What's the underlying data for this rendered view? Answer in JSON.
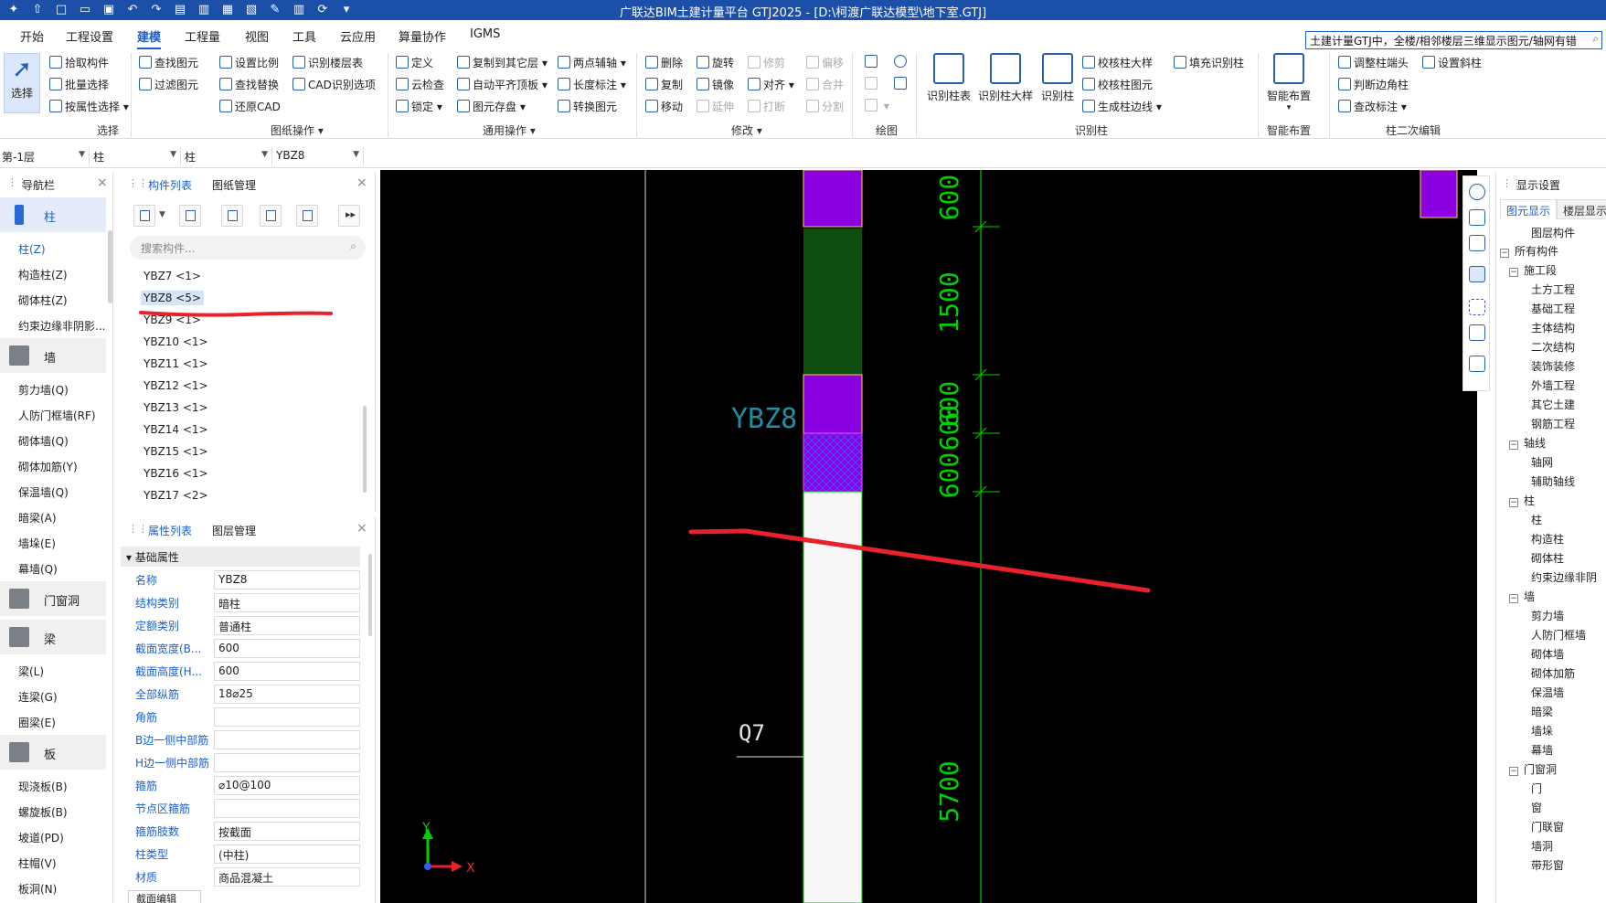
{
  "window": {
    "title": "广联达BIM土建计量平台 GTJ2025 - [D:\\柯渡广联达模型\\地下室.GTJ]"
  },
  "menu": {
    "tabs": [
      "开始",
      "工程设置",
      "建模",
      "工程量",
      "视图",
      "工具",
      "云应用",
      "算量协作",
      "IGMS"
    ],
    "active": "建模",
    "search_value": "土建计量GTJ中，全楼/相邻楼层三维显示图元/轴网有错"
  },
  "ribbon": {
    "select": {
      "big": "选择",
      "items": [
        "拾取构件",
        "批量选择",
        "按属性选择"
      ],
      "group": "选择"
    },
    "drawing_ops": {
      "items": [
        "查找图元",
        "过滤图元",
        "设置比例",
        "查找替换",
        "还原CAD",
        "识别楼层表",
        "CAD识别选项"
      ],
      "group": "图纸操作"
    },
    "general_ops": {
      "items": [
        "定义",
        "云检查",
        "锁定",
        "复制到其它层",
        "自动平齐顶板",
        "图元存盘",
        "两点辅轴",
        "长度标注",
        "转换图元"
      ],
      "group": "通用操作"
    },
    "modify": {
      "items": [
        "删除",
        "复制",
        "移动",
        "旋转",
        "镜像",
        "延伸",
        "修剪",
        "对齐",
        "打断",
        "偏移",
        "合并",
        "分割"
      ],
      "group": "修改"
    },
    "draw": {
      "group": "绘图"
    },
    "identify_column": {
      "bigs": [
        "识别柱表",
        "识别柱大样",
        "识别柱"
      ],
      "items": [
        "校核柱大样",
        "校核柱图元",
        "生成柱边线",
        "填充识别柱"
      ],
      "group": "识别柱"
    },
    "smart_layout": {
      "big": "智能布置",
      "group": "智能布置"
    },
    "column_secondary": {
      "items": [
        "调整柱端头",
        "判断边角柱",
        "查改标注",
        "设置斜柱"
      ],
      "group": "柱二次编辑"
    }
  },
  "layerbar": {
    "floor": "第-1层",
    "type": "柱",
    "subtype": "柱",
    "component": "YBZ8"
  },
  "nav": {
    "title": "导航栏",
    "categories": [
      {
        "label": "柱",
        "items": [
          "柱(Z)",
          "构造柱(Z)",
          "砌体柱(Z)",
          "约束边缘非阴影..."
        ]
      },
      {
        "label": "墙",
        "items": [
          "剪力墙(Q)",
          "人防门框墙(RF)",
          "砌体墙(Q)",
          "砌体加筋(Y)",
          "保温墙(Q)",
          "暗梁(A)",
          "墙垛(E)",
          "幕墙(Q)"
        ]
      },
      {
        "label": "门窗洞",
        "items": []
      },
      {
        "label": "梁",
        "items": [
          "梁(L)",
          "连梁(G)",
          "圈梁(E)"
        ]
      },
      {
        "label": "板",
        "items": [
          "现浇板(B)",
          "螺旋板(B)",
          "坡道(PD)",
          "柱帽(V)",
          "板洞(N)"
        ]
      }
    ]
  },
  "component_list": {
    "tabs": [
      "构件列表",
      "图纸管理"
    ],
    "search_placeholder": "搜索构件...",
    "items": [
      "YBZ7 <1>",
      "YBZ8 <5>",
      "YBZ9 <1>",
      "YBZ10 <1>",
      "YBZ11 <1>",
      "YBZ12 <1>",
      "YBZ13 <1>",
      "YBZ14 <1>",
      "YBZ15 <1>",
      "YBZ16 <1>",
      "YBZ17 <2>"
    ],
    "selected": "YBZ8 <5>"
  },
  "properties": {
    "tabs": [
      "属性列表",
      "图层管理"
    ],
    "section": "基础属性",
    "rows": [
      {
        "key": "名称",
        "value": "YBZ8"
      },
      {
        "key": "结构类别",
        "value": "暗柱"
      },
      {
        "key": "定额类别",
        "value": "普通柱"
      },
      {
        "key": "截面宽度(B...",
        "value": "600"
      },
      {
        "key": "截面高度(H...",
        "value": "600"
      },
      {
        "key": "全部纵筋",
        "value": "18⌀25"
      },
      {
        "key": "角筋",
        "value": ""
      },
      {
        "key": "B边一侧中部筋",
        "value": ""
      },
      {
        "key": "H边一侧中部筋",
        "value": ""
      },
      {
        "key": "箍筋",
        "value": "⌀10@100"
      },
      {
        "key": "节点区箍筋",
        "value": ""
      },
      {
        "key": "箍筋肢数",
        "value": "按截面"
      },
      {
        "key": "柱类型",
        "value": "(中柱)"
      },
      {
        "key": "材质",
        "value": "商品混凝土"
      }
    ],
    "bottom_tab": "截面编辑"
  },
  "canvas": {
    "label_column": "YBZ8",
    "label_wall": "Q7",
    "dims": [
      "600",
      "1500",
      "600",
      "600",
      "600",
      "5700"
    ],
    "axis_x": "X",
    "axis_y": "Y",
    "colors": {
      "purple": "#8a00e0",
      "green": "#0d4d0d",
      "hatch": "#4a4aff",
      "dim_green": "#00d000",
      "annotation_red": "#e8212b"
    }
  },
  "display": {
    "title": "显示设置",
    "tabs": [
      "图元显示",
      "楼层显示"
    ],
    "header": "图层构件",
    "tree": [
      {
        "level": 0,
        "label": "所有构件",
        "box": "−"
      },
      {
        "level": 1,
        "label": "施工段",
        "box": "−"
      },
      {
        "level": 2,
        "label": "土方工程"
      },
      {
        "level": 2,
        "label": "基础工程"
      },
      {
        "level": 2,
        "label": "主体结构"
      },
      {
        "level": 2,
        "label": "二次结构"
      },
      {
        "level": 2,
        "label": "装饰装修"
      },
      {
        "level": 2,
        "label": "外墙工程"
      },
      {
        "level": 2,
        "label": "其它土建"
      },
      {
        "level": 2,
        "label": "钢筋工程"
      },
      {
        "level": 1,
        "label": "轴线",
        "box": "−"
      },
      {
        "level": 2,
        "label": "轴网"
      },
      {
        "level": 2,
        "label": "辅助轴线"
      },
      {
        "level": 1,
        "label": "柱",
        "box": "−"
      },
      {
        "level": 2,
        "label": "柱"
      },
      {
        "level": 2,
        "label": "构造柱"
      },
      {
        "level": 2,
        "label": "砌体柱"
      },
      {
        "level": 2,
        "label": "约束边缘非阴"
      },
      {
        "level": 1,
        "label": "墙",
        "box": "−"
      },
      {
        "level": 2,
        "label": "剪力墙"
      },
      {
        "level": 2,
        "label": "人防门框墙"
      },
      {
        "level": 2,
        "label": "砌体墙"
      },
      {
        "level": 2,
        "label": "砌体加筋"
      },
      {
        "level": 2,
        "label": "保温墙"
      },
      {
        "level": 2,
        "label": "暗梁"
      },
      {
        "level": 2,
        "label": "墙垛"
      },
      {
        "level": 2,
        "label": "幕墙"
      },
      {
        "level": 1,
        "label": "门窗洞",
        "box": "−"
      },
      {
        "level": 2,
        "label": "门"
      },
      {
        "level": 2,
        "label": "窗"
      },
      {
        "level": 2,
        "label": "门联窗"
      },
      {
        "level": 2,
        "label": "墙洞"
      },
      {
        "level": 2,
        "label": "带形窗"
      }
    ]
  }
}
